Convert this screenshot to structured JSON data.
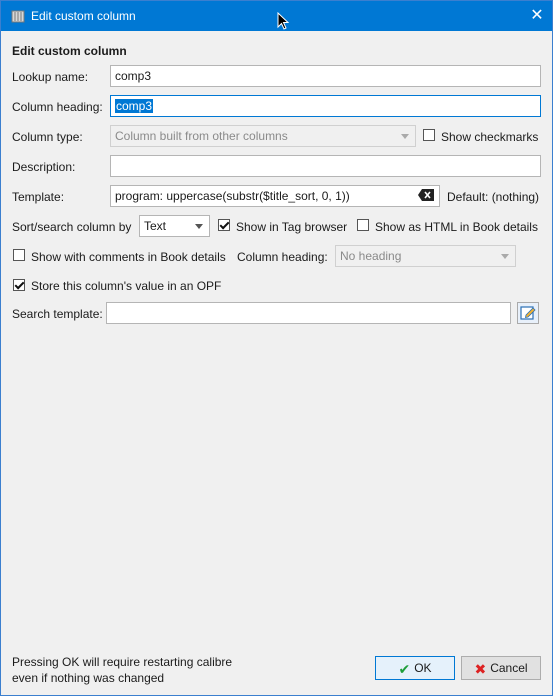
{
  "window": {
    "title": "Edit custom column",
    "close_glyph": "✕",
    "accent": "#0078d4"
  },
  "form": {
    "header": "Edit custom column",
    "lookup_label": "Lookup name:",
    "lookup_value": "comp3",
    "heading_label": "Column heading:",
    "heading_value": "comp3",
    "type_label": "Column type:",
    "type_value": "Column built from other columns",
    "show_checkmarks": "Show checkmarks",
    "description_label": "Description:",
    "description_value": "",
    "template_label": "Template:",
    "template_value": "program: uppercase(substr($title_sort, 0, 1))",
    "template_default": "Default: (nothing)",
    "sort_label": "Sort/search column by",
    "sort_value": "Text",
    "show_tag_browser": "Show in Tag browser",
    "show_tag_browser_checked": true,
    "show_html": "Show as HTML in Book details",
    "show_comments": "Show with comments in Book details",
    "comments_heading_label": "Column heading:",
    "comments_heading_value": "No heading",
    "store_opf": "Store this column's value in an OPF",
    "store_opf_checked": true,
    "search_template_label": "Search template:",
    "search_template_value": ""
  },
  "footer": {
    "note_line1": "Pressing OK will require restarting calibre",
    "note_line2": "even if nothing was changed",
    "ok_label": "OK",
    "cancel_label": "Cancel",
    "ok_icon": "checkmark-icon",
    "cancel_icon": "x-icon"
  }
}
